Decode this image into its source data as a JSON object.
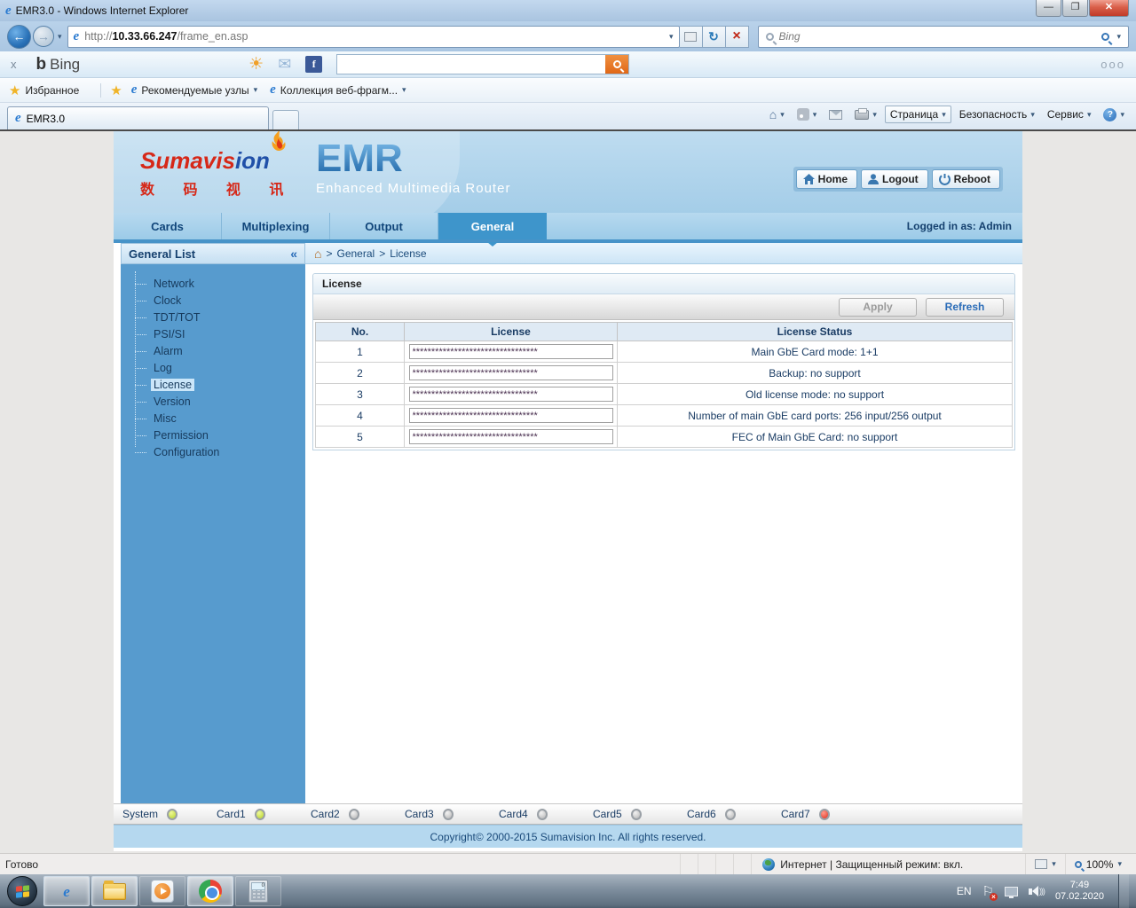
{
  "browser": {
    "title": "EMR3.0 - Windows Internet Explorer",
    "url_scheme": "http://",
    "url_host": "10.33.66.247",
    "url_path": "/frame_en.asp",
    "min_glyph": "—",
    "max_glyph": "❐",
    "close_glyph": "✕",
    "back_glyph": "←",
    "fwd_glyph": "→",
    "refresh_glyph": "↻",
    "stop_glyph": "×",
    "search_placeholder": "Bing",
    "bing_toolbar": {
      "close_label": "x",
      "logo_text": "Bing",
      "more_dots": "ooo"
    },
    "favorites_bar": {
      "favorites_label": "Избранное",
      "suggested_label": "Рекомендуемые узлы",
      "fragments_label": "Коллекция веб-фрагм..."
    },
    "tab_title": "EMR3.0",
    "commands": {
      "page": "Страница",
      "security": "Безопасность",
      "tools": "Сервис"
    },
    "statusbar": {
      "ready": "Готово",
      "zone": "Интернет | Защищенный режим: вкл.",
      "zoom": "100%"
    }
  },
  "app": {
    "brand": {
      "name_red": "Sumavis",
      "name_blue": "ion",
      "cjk": "数 码 视 讯"
    },
    "title": "EMR",
    "subtitle": "Enhanced Multimedia Router",
    "actions": {
      "home": "Home",
      "logout": "Logout",
      "reboot": "Reboot"
    },
    "tabs": [
      "Cards",
      "Multiplexing",
      "Output",
      "General"
    ],
    "logged_in": "Logged in as: Admin",
    "sidebar": {
      "title": "General List",
      "collapse_glyph": "«",
      "items": [
        "Network",
        "Clock",
        "TDT/TOT",
        "PSI/SI",
        "Alarm",
        "Log",
        "License",
        "Version",
        "Misc",
        "Permission",
        "Configuration"
      ]
    },
    "breadcrumb": {
      "sep": ">",
      "level1": "General",
      "level2": "License"
    },
    "panel": {
      "title": "License",
      "apply_label": "Apply",
      "refresh_label": "Refresh",
      "headers": [
        "No.",
        "License",
        "License Status"
      ],
      "rows": [
        {
          "no": "1",
          "license": "*********************************",
          "status": "Main GbE Card mode: 1+1"
        },
        {
          "no": "2",
          "license": "*********************************",
          "status": "Backup: no support"
        },
        {
          "no": "3",
          "license": "*********************************",
          "status": "Old license mode: no support"
        },
        {
          "no": "4",
          "license": "*********************************",
          "status": "Number of main GbE card ports: 256 input/256 output"
        },
        {
          "no": "5",
          "license": "*********************************",
          "status": "FEC of Main GbE Card: no support"
        }
      ]
    },
    "cards": [
      {
        "label": "System",
        "state": "green"
      },
      {
        "label": "Card1",
        "state": "green"
      },
      {
        "label": "Card2",
        "state": "gray"
      },
      {
        "label": "Card3",
        "state": "gray"
      },
      {
        "label": "Card4",
        "state": "gray"
      },
      {
        "label": "Card5",
        "state": "gray"
      },
      {
        "label": "Card6",
        "state": "gray"
      },
      {
        "label": "Card7",
        "state": "red"
      }
    ],
    "copyright": "Copyright© 2000-2015 Sumavision Inc. All rights reserved."
  },
  "taskbar": {
    "lang": "EN",
    "time": "7:49",
    "date": "07.02.2020"
  }
}
